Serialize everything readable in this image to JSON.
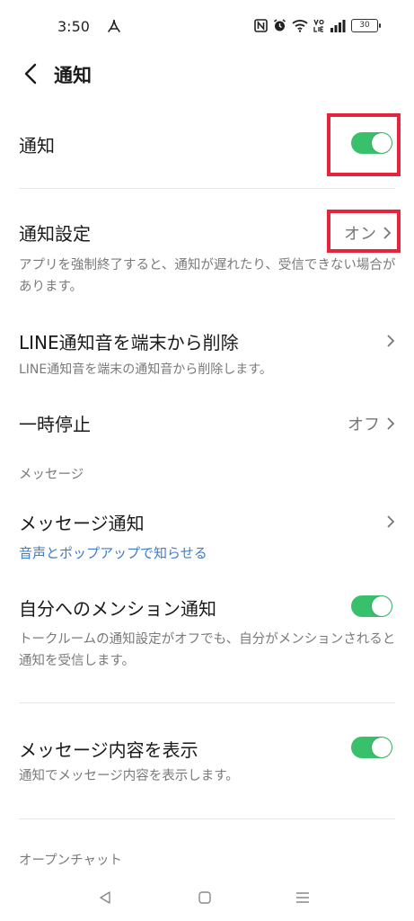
{
  "status_bar": {
    "time": "3:50",
    "battery": "30",
    "icons": [
      "pdf-icon",
      "nfc-icon",
      "alarm-icon",
      "wifi-icon",
      "volte-icon",
      "signal-icon",
      "battery-icon"
    ]
  },
  "header": {
    "title": "通知"
  },
  "rows": {
    "notification": {
      "title": "通知",
      "enabled": true
    },
    "notification_settings": {
      "title": "通知設定",
      "value": "オン",
      "description": "アプリを強制終了すると、通知が遅れたり、受信できない場合があります。"
    },
    "delete_sound": {
      "title": "LINE通知音を端末から削除",
      "description": "LINE通知音を端末の通知音から削除します。"
    },
    "pause": {
      "title": "一時停止",
      "value": "オフ"
    },
    "message_section": "メッセージ",
    "message_notification": {
      "title": "メッセージ通知",
      "link": "音声とポップアップで知らせる"
    },
    "mention_notification": {
      "title": "自分へのメンション通知",
      "description": "トークルームの通知設定がオフでも、自分がメンションされると通知を受信します。",
      "enabled": true
    },
    "show_content": {
      "title": "メッセージ内容を表示",
      "description": "通知でメッセージ内容を表示します。",
      "enabled": true
    },
    "openchat_section": "オープンチャット"
  },
  "colors": {
    "toggle_on": "#39c06c",
    "highlight": "#e6243c",
    "link": "#3f7bc8"
  }
}
